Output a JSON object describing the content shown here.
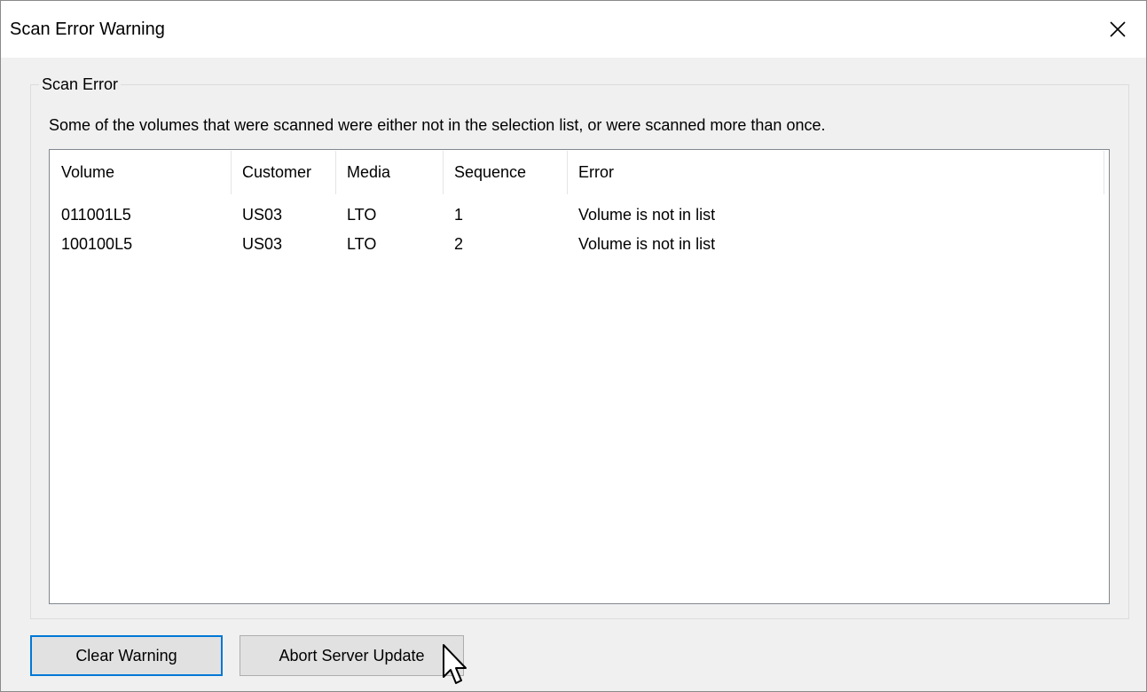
{
  "window": {
    "title": "Scan Error Warning",
    "close_icon": "close-icon"
  },
  "group": {
    "legend": "Scan Error",
    "message": "Some of the volumes that were scanned were either not in the selection list, or were scanned more than once."
  },
  "table": {
    "columns": [
      "Volume",
      "Customer",
      "Media",
      "Sequence",
      "Error"
    ],
    "rows": [
      [
        "011001L5",
        "US03",
        "LTO",
        "1",
        "Volume is not in list"
      ],
      [
        "100100L5",
        "US03",
        "LTO",
        "2",
        "Volume is not in list"
      ]
    ]
  },
  "buttons": {
    "clear": "Clear Warning",
    "abort": "Abort Server Update"
  },
  "colors": {
    "focus_border": "#0078d7",
    "button_face": "#e1e1e1",
    "dialog_bg": "#f0f0f0"
  }
}
